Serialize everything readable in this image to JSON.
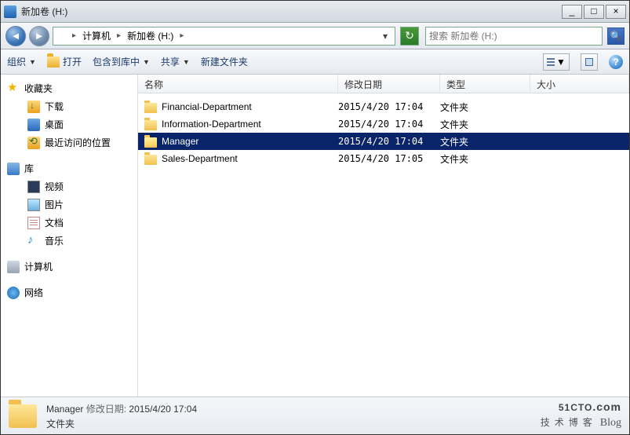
{
  "window": {
    "title": "新加卷 (H:)"
  },
  "winbuttons": {
    "min": "_",
    "max": "□",
    "close": "×"
  },
  "nav": {
    "crumb1": "计算机",
    "crumb2": "新加卷 (H:)"
  },
  "search": {
    "placeholder": "搜索 新加卷 (H:)"
  },
  "toolbar": {
    "organize": "组织",
    "open": "打开",
    "include": "包含到库中",
    "share": "共享",
    "newfolder": "新建文件夹"
  },
  "sidebar": {
    "favorites": "收藏夹",
    "fav_items": {
      "downloads": "下载",
      "desktop": "桌面",
      "recent": "最近访问的位置"
    },
    "libraries": "库",
    "lib_items": {
      "videos": "视频",
      "pictures": "图片",
      "documents": "文档",
      "music": "音乐"
    },
    "computer": "计算机",
    "network": "网络"
  },
  "columns": {
    "name": "名称",
    "date": "修改日期",
    "type": "类型",
    "size": "大小"
  },
  "rows": [
    {
      "name": "Financial-Department",
      "date": "2015/4/20 17:04",
      "type": "文件夹",
      "selected": false
    },
    {
      "name": "Information-Department",
      "date": "2015/4/20 17:04",
      "type": "文件夹",
      "selected": false
    },
    {
      "name": "Manager",
      "date": "2015/4/20 17:04",
      "type": "文件夹",
      "selected": true
    },
    {
      "name": "Sales-Department",
      "date": "2015/4/20 17:05",
      "type": "文件夹",
      "selected": false
    }
  ],
  "status": {
    "line1_name": "Manager",
    "line1_label": "修改日期:",
    "line1_value": "2015/4/20 17:04",
    "line2": "文件夹"
  },
  "watermark": {
    "brand": "51CTO",
    "com": ".com",
    "sub": "技术博客",
    "blog": "Blog"
  }
}
